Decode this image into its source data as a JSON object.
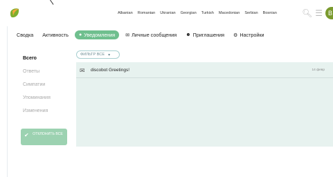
{
  "header": {
    "languages": [
      "Albanian",
      "Romanian",
      "Ukranian",
      "Georgian",
      "Turkish",
      "Macedonian",
      "Serbian",
      "Bosnian"
    ],
    "search_icon": "search-icon",
    "menu_icon": "hamburger-menu-icon",
    "avatar_letter": "B",
    "brand_color": "#7a9a2e"
  },
  "nav": {
    "tabs": [
      {
        "label": "Сводка"
      },
      {
        "label": "Активность"
      },
      {
        "label": "Уведомления",
        "active": true
      },
      {
        "label": "Личные сообщения"
      },
      {
        "label": "Приглашения"
      },
      {
        "label": "Настройки"
      }
    ],
    "accent_color": "#6fbf8e"
  },
  "sidebar": {
    "items": [
      {
        "label": "Всего",
        "selected": true
      },
      {
        "label": "Ответы"
      },
      {
        "label": "Симпатии"
      },
      {
        "label": "Упоминания"
      },
      {
        "label": "Изменения"
      }
    ],
    "dismiss_label": "ОТКЛОНИТЬ ВСЕ"
  },
  "filter": {
    "label": "ФИЛЬТР",
    "value": "ВСЕ"
  },
  "notifications": [
    {
      "text": "discobot Greetings!",
      "date": "14 февр"
    }
  ]
}
